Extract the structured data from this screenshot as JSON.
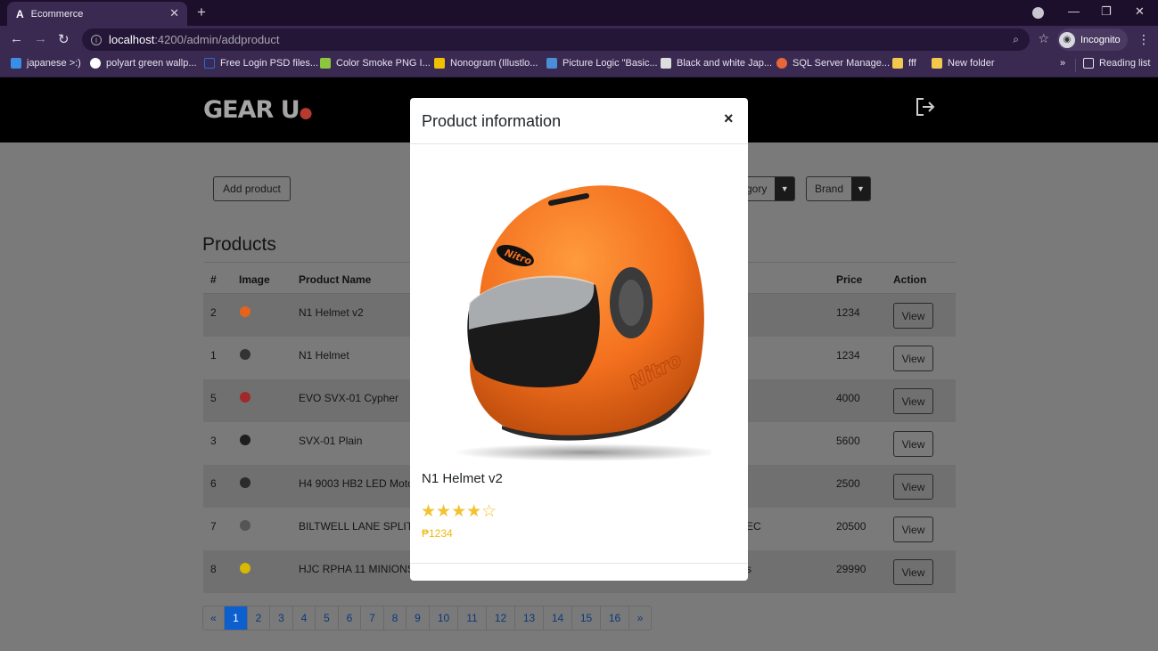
{
  "browser": {
    "tab_title": "Ecommerce",
    "tab_favicon": "A",
    "url_host": "localhost",
    "url_path": ":4200/admin/addproduct",
    "profile_label": "Incognito",
    "bookmarks": [
      {
        "label": "japanese >:)",
        "color": "#3a8ee6"
      },
      {
        "label": "polyart green wallp...",
        "color": "#ffffff"
      },
      {
        "label": "Free Login PSD files...",
        "color": "#2a6ad8"
      },
      {
        "label": "Color Smoke PNG I...",
        "color": "#8cc63f"
      },
      {
        "label": "Nonogram (Illustlo...",
        "color": "#f0c000"
      },
      {
        "label": "Picture Logic \"Basic...",
        "color": "#4a8ed8"
      },
      {
        "label": "Black and white Jap...",
        "color": "#dddddd"
      },
      {
        "label": "SQL Server Manage...",
        "color": "#e8663a"
      },
      {
        "label": "fff",
        "color": "#f2c94c"
      },
      {
        "label": "New folder",
        "color": "#f2c94c"
      }
    ],
    "more_bookmarks": "»",
    "reading_list": "Reading list"
  },
  "app": {
    "logo_main": "GEAR U",
    "add_button": "Add product",
    "category_dropdown": "gory",
    "brand_dropdown": "Brand",
    "products_title": "Products",
    "columns": [
      "#",
      "Image",
      "Product Name",
      "Price",
      "Action"
    ],
    "rows": [
      {
        "id": "2",
        "name": "N1 Helmet v2",
        "extra": "",
        "price": "1234",
        "thumb": "#e8631a",
        "action": "View"
      },
      {
        "id": "1",
        "name": "N1 Helmet",
        "extra": "",
        "price": "1234",
        "thumb": "#333333",
        "action": "View"
      },
      {
        "id": "5",
        "name": "EVO SVX-01 Cypher",
        "extra": "",
        "price": "4000",
        "thumb": "#a02a2a",
        "action": "View"
      },
      {
        "id": "3",
        "name": "SVX-01 Plain",
        "extra": "",
        "price": "5600",
        "thumb": "#1e1e1e",
        "action": "View"
      },
      {
        "id": "6",
        "name": "H4 9003 HB2 LED Moto",
        "extra": "",
        "price": "2500",
        "thumb": "#2b2b2b",
        "action": "View"
      },
      {
        "id": "7",
        "name": "BILTWELL LANE SPLITTE",
        "extra": "EC",
        "price": "20500",
        "thumb": "#555555",
        "action": "View"
      },
      {
        "id": "8",
        "name": "HJC RPHA 11 MINIONS",
        "extra": "s",
        "price": "29990",
        "thumb": "#d8b800",
        "action": "View"
      }
    ],
    "pagination": [
      "«",
      "1",
      "2",
      "3",
      "4",
      "5",
      "6",
      "7",
      "8",
      "9",
      "10",
      "11",
      "12",
      "13",
      "14",
      "15",
      "16",
      "»"
    ],
    "current_page": "1"
  },
  "modal": {
    "title": "Product information",
    "close": "×",
    "product_name": "N1 Helmet v2",
    "stars": "★★★★☆",
    "rating": 4,
    "rating_max": 5,
    "price": "₱1234",
    "helmet_brand_text": "Nitro",
    "helmet_color": "#f3701e"
  }
}
